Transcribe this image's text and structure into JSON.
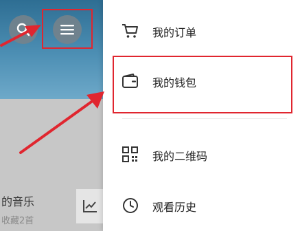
{
  "background_app": {
    "music_title": "的音乐",
    "music_subtitle": "收藏2首"
  },
  "drawer": {
    "items": [
      {
        "label": "我的订单",
        "icon": "cart-icon"
      },
      {
        "label": "我的钱包",
        "icon": "wallet-icon"
      },
      {
        "label": "我的二维码",
        "icon": "qr-code-icon"
      },
      {
        "label": "观看历史",
        "icon": "clock-icon"
      }
    ]
  },
  "colors": {
    "annotation_red": "#e0262f",
    "header_blue": "#3f80a7",
    "icon_dark": "#333333"
  }
}
